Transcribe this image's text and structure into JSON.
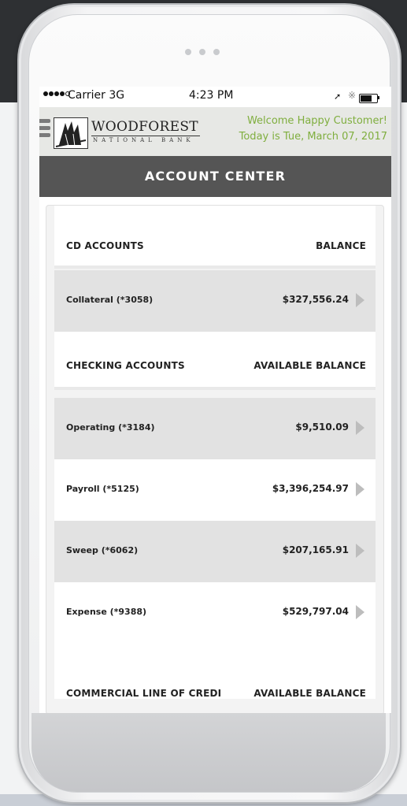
{
  "status_bar": {
    "carrier": "Carrier 3G",
    "time": "4:23 PM",
    "battery_level": 0.7
  },
  "header": {
    "bank_name": "WOODFOREST",
    "bank_sub": "NATIONAL BANK",
    "welcome_line1": "Welcome Happy Customer!",
    "welcome_line2": "Today is Tue, March 07, 2017"
  },
  "title": "ACCOUNT CENTER",
  "sections": {
    "cd": {
      "label": "CD ACCOUNTS",
      "balance_label": "BALANCE",
      "accounts": [
        {
          "name": "Collateral (*3058)",
          "balance": "$327,556.24"
        }
      ]
    },
    "checking": {
      "label": "CHECKING ACCOUNTS",
      "balance_label": "AVAILABLE BALANCE",
      "accounts": [
        {
          "name": "Operating (*3184)",
          "balance": "$9,510.09"
        },
        {
          "name": "Payroll (*5125)",
          "balance": "$3,396,254.97"
        },
        {
          "name": "Sweep (*6062)",
          "balance": "$207,165.91"
        },
        {
          "name": "Expense (*9388)",
          "balance": "$529,797.04"
        }
      ]
    },
    "commercial": {
      "label": "COMMERCIAL LINE OF CREDI",
      "balance_label": "AVAILABLE BALANCE"
    }
  },
  "icons": [
    "menu-icon",
    "woodforest-logo",
    "chevron-right-icon",
    "location-arrow-icon",
    "bluetooth-icon",
    "battery-icon"
  ],
  "colors": {
    "welcome_green": "#7fae3e",
    "title_bar": "#555555",
    "row_shaded": "#e2e2e2"
  }
}
